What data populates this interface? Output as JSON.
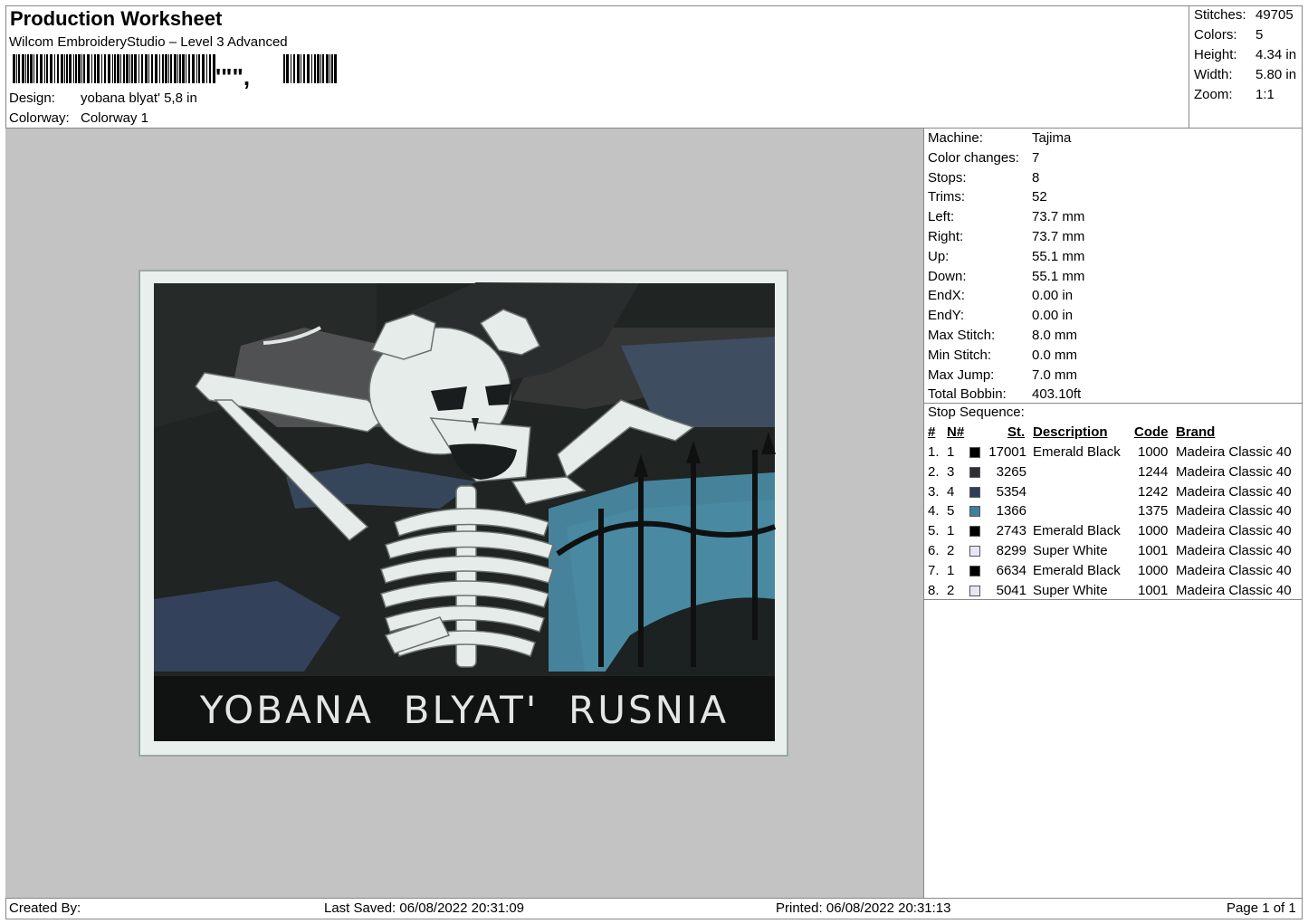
{
  "header": {
    "title": "Production Worksheet",
    "software": "Wilcom EmbroideryStudio – Level 3 Advanced",
    "barcode_text": "'\"\",",
    "design_label": "Design:",
    "design_value": "yobana blyat' 5,8 in",
    "colorway_label": "Colorway:",
    "colorway_value": "Colorway 1"
  },
  "stats": {
    "stitches_label": "Stitches:",
    "stitches_value": "49705",
    "colors_label": "Colors:",
    "colors_value": "5",
    "height_label": "Height:",
    "height_value": "4.34 in",
    "width_label": "Width:",
    "width_value": "5.80 in",
    "zoom_label": "Zoom:",
    "zoom_value": "1:1"
  },
  "design_preview": {
    "patch_text": "YOBANA  BLYAT'  RUSNIA"
  },
  "machine_info": [
    {
      "label": "Machine:",
      "value": "Tajima"
    },
    {
      "label": "Color changes:",
      "value": "7"
    },
    {
      "label": "Stops:",
      "value": "8"
    },
    {
      "label": "Trims:",
      "value": "52"
    },
    {
      "label": "Left:",
      "value": "73.7 mm"
    },
    {
      "label": "Right:",
      "value": "73.7 mm"
    },
    {
      "label": "Up:",
      "value": "55.1 mm"
    },
    {
      "label": "Down:",
      "value": "55.1 mm"
    },
    {
      "label": "EndX:",
      "value": "0.00 in"
    },
    {
      "label": "EndY:",
      "value": "0.00 in"
    },
    {
      "label": "Max Stitch:",
      "value": "8.0 mm"
    },
    {
      "label": "Min Stitch:",
      "value": "0.0 mm"
    },
    {
      "label": "Max Jump:",
      "value": "7.0 mm"
    },
    {
      "label": "Total Bobbin:",
      "value": "403.10ft"
    }
  ],
  "stop_sequence": {
    "title": "Stop Sequence:",
    "headers": {
      "num": "#",
      "n": "N#",
      "st": "St.",
      "description": "Description",
      "code": "Code",
      "brand": "Brand"
    },
    "rows": [
      {
        "num": "1.",
        "n": "1",
        "color": "#000000",
        "st": "17001",
        "description": "Emerald Black",
        "code": "1000",
        "brand": "Madeira Classic 40"
      },
      {
        "num": "2.",
        "n": "3",
        "color": "#2d2f35",
        "st": "3265",
        "description": "",
        "code": "1244",
        "brand": "Madeira Classic 40"
      },
      {
        "num": "3.",
        "n": "4",
        "color": "#2b3f5c",
        "st": "5354",
        "description": "",
        "code": "1242",
        "brand": "Madeira Classic 40"
      },
      {
        "num": "4.",
        "n": "5",
        "color": "#3f7f9f",
        "st": "1366",
        "description": "",
        "code": "1375",
        "brand": "Madeira Classic 40"
      },
      {
        "num": "5.",
        "n": "1",
        "color": "#000000",
        "st": "2743",
        "description": "Emerald Black",
        "code": "1000",
        "brand": "Madeira Classic 40"
      },
      {
        "num": "6.",
        "n": "2",
        "color": "#e6e6f4",
        "st": "8299",
        "description": "Super White",
        "code": "1001",
        "brand": "Madeira Classic 40"
      },
      {
        "num": "7.",
        "n": "1",
        "color": "#000000",
        "st": "6634",
        "description": "Emerald Black",
        "code": "1000",
        "brand": "Madeira Classic 40"
      },
      {
        "num": "8.",
        "n": "2",
        "color": "#e6e6f4",
        "st": "5041",
        "description": "Super White",
        "code": "1001",
        "brand": "Madeira Classic 40"
      }
    ]
  },
  "footer": {
    "created_by": "Created By:",
    "last_saved": "Last Saved: 06/08/2022 20:31:09",
    "printed": "Printed: 06/08/2022 20:31:13",
    "page": "Page 1 of 1"
  }
}
